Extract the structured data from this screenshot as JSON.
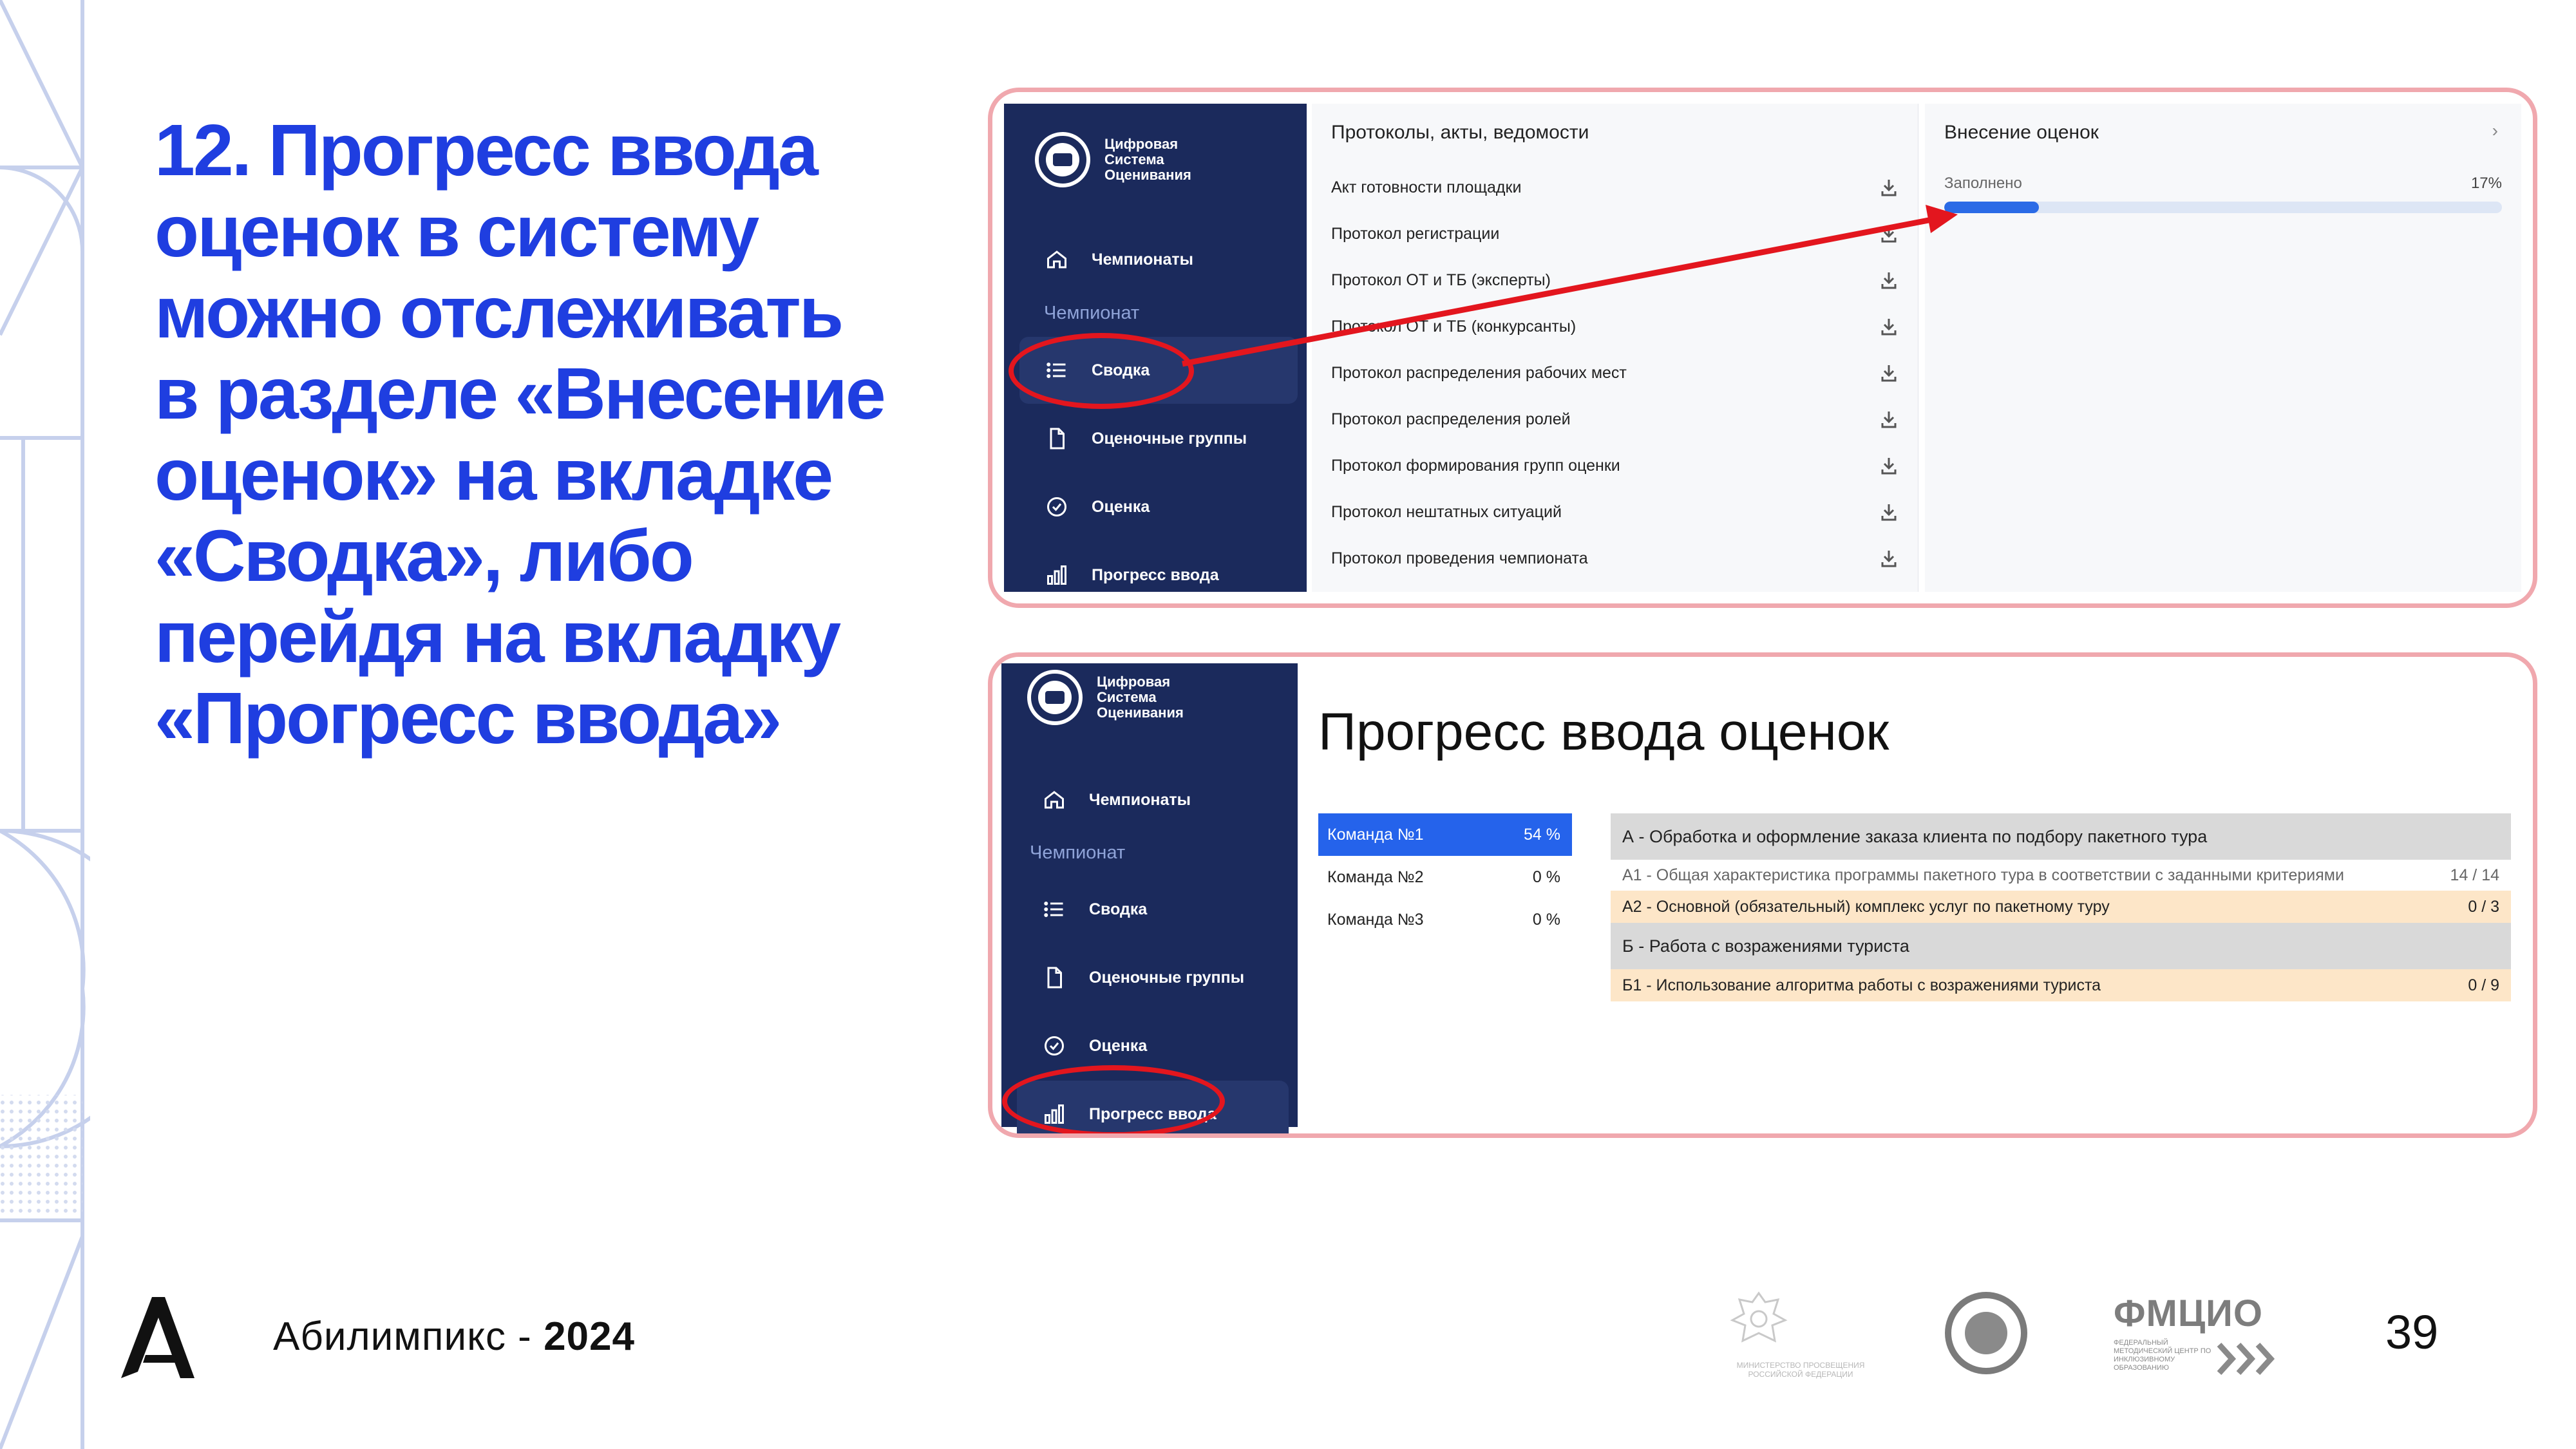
{
  "heading": {
    "lines": [
      "12. Прогресс ввода",
      "оценок в систему",
      "можно отслеживать",
      "в разделе «Внесение",
      "оценок» на вкладке",
      "«Сводка», либо",
      "перейдя на вкладку",
      "«Прогресс ввода»"
    ]
  },
  "colors": {
    "accent": "#1f3ee0",
    "sidebar": "#1b2a5c",
    "annotation": "#e3161e",
    "frame_border": "#f0a8ae"
  },
  "app": {
    "logo_text": "Цифровая Система Оценивания",
    "menu": {
      "championships": "Чемпионаты",
      "section": "Чемпионат",
      "summary": "Сводка",
      "groups": "Оценочные группы",
      "grading": "Оценка",
      "progress": "Прогресс ввода"
    }
  },
  "screen1": {
    "docs_title": "Протоколы, акты, ведомости",
    "docs": [
      "Акт готовности площадки",
      "Протокол регистрации",
      "Протокол ОТ и ТБ (эксперты)",
      "Протокол ОТ и ТБ (конкурсанты)",
      "Протокол распределения рабочих мест",
      "Протокол распределения ролей",
      "Протокол формирования групп оценки",
      "Протокол нештатных ситуаций",
      "Протокол проведения чемпионата"
    ],
    "grades": {
      "title": "Внесение оценок",
      "label": "Заполнено",
      "percent_text": "17%",
      "fraction": 0.17
    }
  },
  "screen2": {
    "title": "Прогресс ввода оценок",
    "teams": [
      {
        "name": "Команда №1",
        "pct": "54 %",
        "selected": true
      },
      {
        "name": "Команда №2",
        "pct": "0 %",
        "selected": false
      },
      {
        "name": "Команда №3",
        "pct": "0 %",
        "selected": false
      }
    ],
    "criteria": [
      {
        "kind": "head",
        "text": "А - Обработка и оформление заказа клиента по подбору пакетного тура",
        "score": ""
      },
      {
        "kind": "sub",
        "text": "А1 - Общая характеристика программы пакетного тура в соответствии с заданными критериями",
        "score": "14 / 14"
      },
      {
        "kind": "ora",
        "text": "А2 - Основной (обязательный) комплекс услуг по пакетному туру",
        "score": "0 / 3"
      },
      {
        "kind": "head",
        "text": "Б - Работа с возражениями туриста",
        "score": ""
      },
      {
        "kind": "ora",
        "text": "Б1 - Использование алгоритма работы с возражениями туриста",
        "score": "0 / 9"
      }
    ]
  },
  "footer": {
    "brand_name": "Абилимпикс - ",
    "brand_year": "2024",
    "partner1_caption": "МИНИСТЕРСТВО ПРОСВЕЩЕНИЯ РОССИЙСКОЙ ФЕДЕРАЦИИ",
    "partner3_name": "ФМЦИО",
    "partner3_caption": "ФЕДЕРАЛЬНЫЙ МЕТОДИЧЕСКИЙ ЦЕНТР ПО ИНКЛЮЗИВНОМУ ОБРАЗОВАНИЮ",
    "page_number": "39"
  }
}
